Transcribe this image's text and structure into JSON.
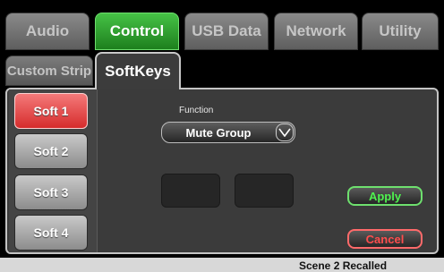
{
  "top_tabs": [
    {
      "label": "Audio",
      "active": false
    },
    {
      "label": "Control",
      "active": true
    },
    {
      "label": "USB Data",
      "active": false
    },
    {
      "label": "Network",
      "active": false
    },
    {
      "label": "Utility",
      "active": false
    }
  ],
  "sub_tabs": [
    {
      "label": "Custom Strip",
      "active": false
    },
    {
      "label": "SoftKeys",
      "active": true
    }
  ],
  "soft_keys": [
    {
      "label": "Soft 1",
      "selected": true
    },
    {
      "label": "Soft 2",
      "selected": false
    },
    {
      "label": "Soft 3",
      "selected": false
    },
    {
      "label": "Soft 4",
      "selected": false
    }
  ],
  "function": {
    "label": "Function",
    "value": "Mute Group",
    "icon": "chevron-down-icon"
  },
  "actions": {
    "apply": "Apply",
    "cancel": "Cancel"
  },
  "status_text": "Scene 2 Recalled",
  "colors": {
    "active_tab": "#2fa02f",
    "selected_key": "#e84a4a",
    "apply": "#4ff24f",
    "cancel": "#ff4d4d"
  }
}
